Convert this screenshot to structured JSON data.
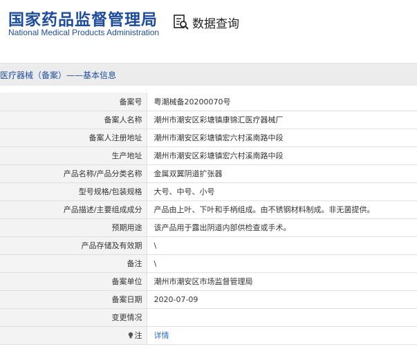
{
  "header": {
    "logo_cn": "国家药品监督管理局",
    "logo_en": "National Medical Products Administration",
    "data_query": "数据查询"
  },
  "section": {
    "title": "医疗器械（备案）——基本信息"
  },
  "rows": [
    {
      "label": "备案号",
      "value": "粤潮械备20200070号"
    },
    {
      "label": "备案人名称",
      "value": "潮州市潮安区彩塘镇康锦汇医疗器械厂"
    },
    {
      "label": "备案人注册地址",
      "value": "潮州市潮安区彩塘镇宏六村溪南路中段"
    },
    {
      "label": "生产地址",
      "value": "潮州市潮安区彩塘镇宏六村溪南路中段"
    },
    {
      "label": "产品名称/产品分类名称",
      "value": "金属双翼阴道扩张器"
    },
    {
      "label": "型号规格/包装规格",
      "value": "大号、中号、小号"
    },
    {
      "label": "产品描述/主要组成成分",
      "value": "产品由上叶、下叶和手柄组成。由不锈钢材料制成。非无菌提供。"
    },
    {
      "label": "预期用途",
      "value": "该产品用于露出阴道内部供检查或手术。"
    },
    {
      "label": "产品存储及有效期",
      "value": "\\"
    },
    {
      "label": "备注",
      "value": "\\"
    },
    {
      "label": "备案单位",
      "value": "潮州市潮安区市场监督管理局"
    },
    {
      "label": "备案日期",
      "value": "2020-07-09"
    },
    {
      "label": "变更情况",
      "value": ""
    },
    {
      "label": "注",
      "value": "详情"
    }
  ],
  "colors": {
    "brand_blue": "#1d4c9e",
    "link_blue": "#2b6cc4",
    "label_bg": "#f3f3f3",
    "section_bg": "#ececec"
  }
}
